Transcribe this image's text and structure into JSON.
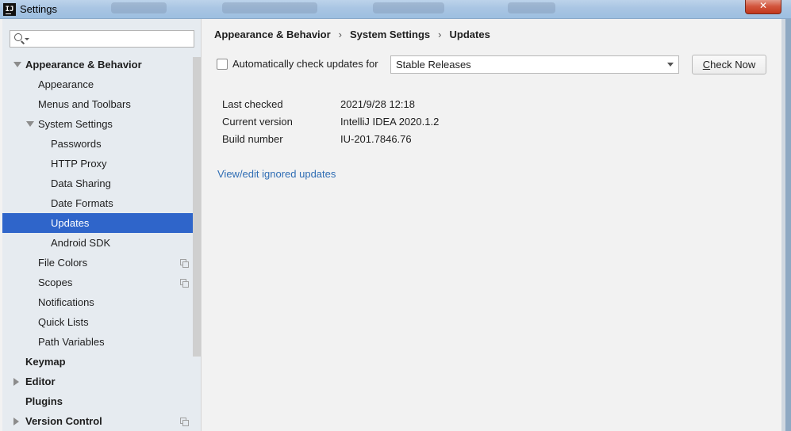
{
  "window": {
    "title": "Settings",
    "app_icon_text": "IJ",
    "close_label": "✕"
  },
  "sidebar": {
    "search": {
      "value": "",
      "placeholder": ""
    },
    "items": [
      {
        "label": "Appearance & Behavior",
        "level": 0,
        "bold": true,
        "expander": "down"
      },
      {
        "label": "Appearance",
        "level": 1
      },
      {
        "label": "Menus and Toolbars",
        "level": 1
      },
      {
        "label": "System Settings",
        "level": 1,
        "expander": "down"
      },
      {
        "label": "Passwords",
        "level": 2
      },
      {
        "label": "HTTP Proxy",
        "level": 2
      },
      {
        "label": "Data Sharing",
        "level": 2
      },
      {
        "label": "Date Formats",
        "level": 2
      },
      {
        "label": "Updates",
        "level": 2,
        "selected": true
      },
      {
        "label": "Android SDK",
        "level": 2
      },
      {
        "label": "File Colors",
        "level": 1,
        "copy_icon": true
      },
      {
        "label": "Scopes",
        "level": 1,
        "copy_icon": true
      },
      {
        "label": "Notifications",
        "level": 1
      },
      {
        "label": "Quick Lists",
        "level": 1
      },
      {
        "label": "Path Variables",
        "level": 1
      },
      {
        "label": "Keymap",
        "level": 0,
        "bold": true
      },
      {
        "label": "Editor",
        "level": 0,
        "bold": true,
        "expander": "right"
      },
      {
        "label": "Plugins",
        "level": 0,
        "bold": true
      },
      {
        "label": "Version Control",
        "level": 0,
        "bold": true,
        "expander": "right",
        "copy_icon": true
      }
    ]
  },
  "breadcrumb": [
    "Appearance & Behavior",
    "System Settings",
    "Updates"
  ],
  "breadcrumb_separator": "›",
  "updates": {
    "auto_check_label": "Automatically check updates for",
    "auto_check_checked": false,
    "channel_value": "Stable Releases",
    "check_now_first": "C",
    "check_now_rest": "heck Now",
    "info": [
      {
        "key": "Last checked",
        "value": "2021/9/28 12:18"
      },
      {
        "key": "Current version",
        "value": "IntelliJ IDEA 2020.1.2"
      },
      {
        "key": "Build number",
        "value": "IU-201.7846.76"
      }
    ],
    "ignored_link": "View/edit ignored updates"
  },
  "colors": {
    "selection": "#2f65ca",
    "link": "#2f6db4",
    "sidebar_bg": "#e6ebf0",
    "main_bg": "#f2f2f2"
  }
}
